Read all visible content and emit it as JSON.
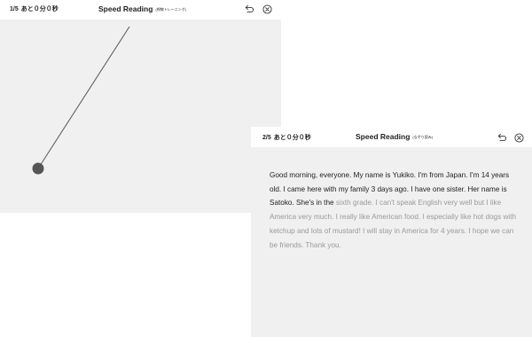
{
  "panels": [
    {
      "progress": "1/5",
      "remaining": "あと０分０秒",
      "title": "Speed Reading",
      "subtitle": "(視線トレーニング)"
    },
    {
      "progress": "2/5",
      "remaining": "あと０分０秒",
      "title": "Speed Reading",
      "subtitle": "(なぞり読み)",
      "text_read": "Good morning, everyone. My name is Yukiko. I'm from Japan. I'm 14 years old. I came here with my family 3 days ago. I have one sister. Her name is Satoko. She's in the ",
      "text_unread": "sixth grade. I can't speak English very well but I like America very much. I really like American food. I especially like hot dogs with ketchup and lots of mustard! I will stay in America for 4 years. I hope we can be friends. Thank you."
    }
  ],
  "icons": {
    "back": "back-arrow-icon",
    "close": "close-circle-icon"
  },
  "colors": {
    "panel_bg": "#f0f0f0",
    "read_text": "#1e1e1e",
    "unread_text": "#9a9a9a",
    "dot": "#555555"
  }
}
